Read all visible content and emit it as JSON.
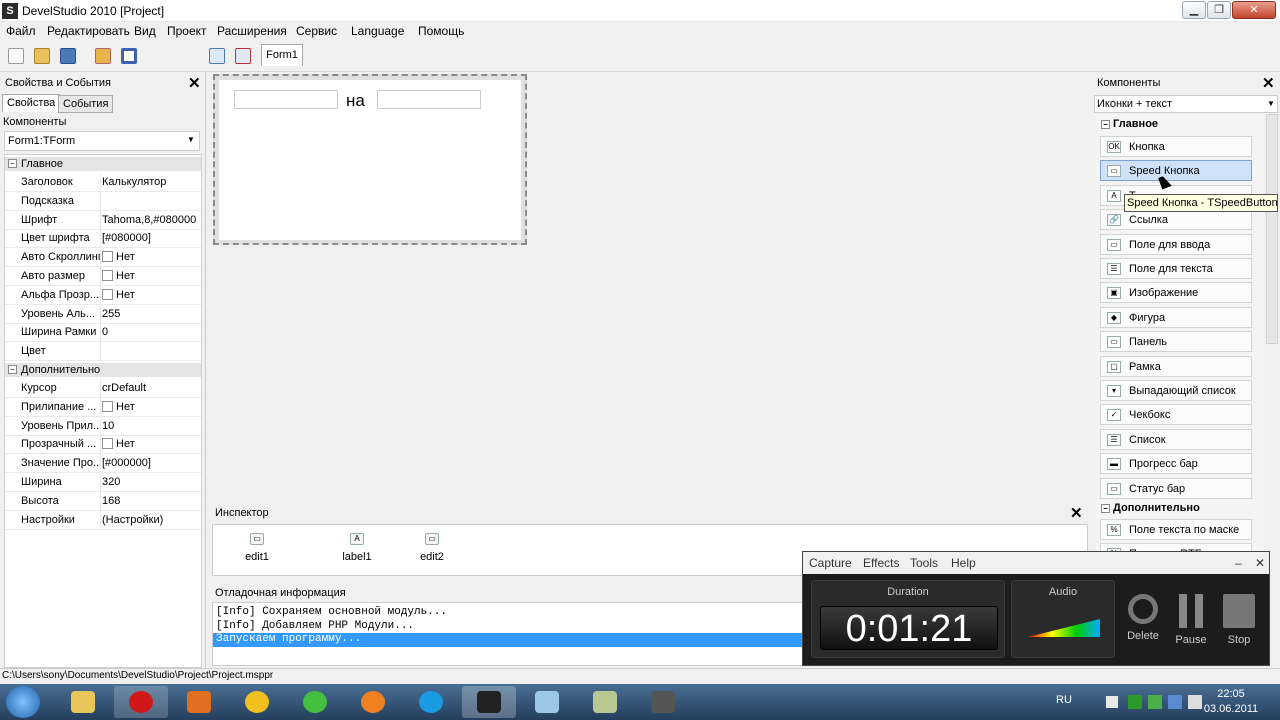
{
  "window": {
    "title": "DevelStudio 2010 [Project]",
    "app_icon": "S"
  },
  "menu": [
    "Файл",
    "Редактировать",
    "Вид",
    "Проект",
    "Расширения",
    "Сервис",
    "Language",
    "Помощь"
  ],
  "toolbar": {
    "form_tab": "Form1"
  },
  "left_panel": {
    "title": "Свойства и События",
    "tabs": [
      "Свойства",
      "События"
    ],
    "components_label": "Компоненты",
    "selected_component": "Form1:TForm",
    "group_main": "Главное",
    "group_extra": "Дополнительно",
    "props_main": [
      {
        "name": "Заголовок",
        "value": "Калькулятор"
      },
      {
        "name": "Подсказка",
        "value": ""
      },
      {
        "name": "Шрифт",
        "value": "Tahoma,8,#080000"
      },
      {
        "name": "Цвет шрифта",
        "value": "[#080000]"
      },
      {
        "name": "Авто Скроллинг",
        "value": "Нет"
      },
      {
        "name": "Авто размер",
        "value": "Нет"
      },
      {
        "name": "Альфа Прозр...",
        "value": "Нет"
      },
      {
        "name": "Уровень Аль...",
        "value": "255"
      },
      {
        "name": "Ширина Рамки",
        "value": "0"
      },
      {
        "name": "Цвет",
        "value": ""
      }
    ],
    "props_extra": [
      {
        "name": "Курсор",
        "value": "crDefault"
      },
      {
        "name": "Прилипание ...",
        "value": "Нет"
      },
      {
        "name": "Уровень Прил...",
        "value": "10"
      },
      {
        "name": "Прозрачный ...",
        "value": "Нет"
      },
      {
        "name": "Значение Про...",
        "value": "[#000000]"
      },
      {
        "name": "Ширина",
        "value": "320"
      },
      {
        "name": "Высота",
        "value": "168"
      },
      {
        "name": "Настройки",
        "value": "(Настройки)"
      }
    ]
  },
  "form": {
    "label_text": "на"
  },
  "inspector": {
    "title": "Инспектор",
    "items": [
      "edit1",
      "label1",
      "edit2"
    ]
  },
  "debug": {
    "title": "Отладочная информация",
    "lines": [
      "[Info] Сохраняем основной модуль...",
      "[Info] Добавляем PHP Модули...",
      "Запускаем программу..."
    ]
  },
  "right_panel": {
    "title": "Компоненты",
    "view_mode": "Иконки + текст",
    "group_main": "Главное",
    "group_extra": "Дополнительно",
    "items_main": [
      "Кнопка",
      "Speed Кнопка",
      "Т...",
      "Ссылка",
      "Поле для ввода",
      "Поле для текста",
      "Изображение",
      "Фигура",
      "Панель",
      "Рамка",
      "Выпадающий список",
      "Чекбокс",
      "Список",
      "Прогресс бар",
      "Статус бар"
    ],
    "items_extra": [
      "Поле текста по маске",
      "Поле для RTF"
    ],
    "tooltip": "Speed Кнопка - TSpeedButton"
  },
  "statusbar": {
    "path": "C:\\Users\\sony\\Documents\\DevelStudio\\Project\\Project.msppr"
  },
  "recorder": {
    "menu": [
      "Capture",
      "Effects",
      "Tools",
      "Help"
    ],
    "duration_label": "Duration",
    "duration": "0:01:21",
    "audio_label": "Audio",
    "delete": "Delete",
    "pause": "Pause",
    "stop": "Stop"
  },
  "taskbar": {
    "language": "RU",
    "time": "22:05",
    "date": "03.06.2011"
  }
}
